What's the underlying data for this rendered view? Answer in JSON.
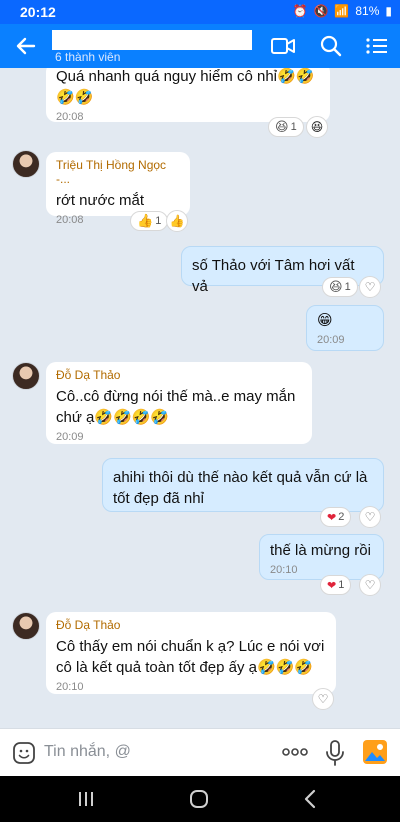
{
  "status": {
    "time": "20:12",
    "battery": "81%"
  },
  "header": {
    "subtitle": "6 thành viên"
  },
  "messages": [
    {
      "type": "in",
      "text1": "Quá nhanh quá nguy hiểm cô nhỉ🤣🤣",
      "text2": "🤣🤣",
      "time": "20:08",
      "reaction_count": "1"
    },
    {
      "type": "in",
      "sender": "Triệu Thị Hồng Ngọc -...",
      "text": "rớt nước mắt",
      "time": "20:08",
      "reaction_count": "1"
    },
    {
      "type": "out",
      "text": "số Thảo với Tâm hơi vất vả",
      "reaction_count": "1"
    },
    {
      "type": "out",
      "text": "😁",
      "time": "20:09"
    },
    {
      "type": "in",
      "sender": "Đỗ Dạ Thảo",
      "text1": "Cô..cô đừng nói thế mà..e may mắn",
      "text2": "chứ ạ🤣🤣🤣🤣",
      "time": "20:09"
    },
    {
      "type": "out",
      "text1": "ahihi thôi dù thế nào kết quả vẫn cứ là",
      "text2": "tốt đẹp đã nhỉ",
      "reaction_count": "2"
    },
    {
      "type": "out",
      "text": "thế là mừng rồi",
      "time": "20:10",
      "reaction_count": "1"
    },
    {
      "type": "in",
      "sender": "Đỗ Dạ Thảo",
      "text1": "Cô thấy em nói chuẩn k ạ? Lúc e nói vơi",
      "text2": "cô là kết quả toàn tốt đẹp ấy ạ🤣🤣🤣",
      "time": "20:10"
    }
  ],
  "input": {
    "placeholder": "Tin nhắn, @"
  },
  "colors": {
    "header": "#0a80ff",
    "status": "#0a68ff",
    "out_bubble": "#d6ecff",
    "heart": "#e0243b"
  }
}
